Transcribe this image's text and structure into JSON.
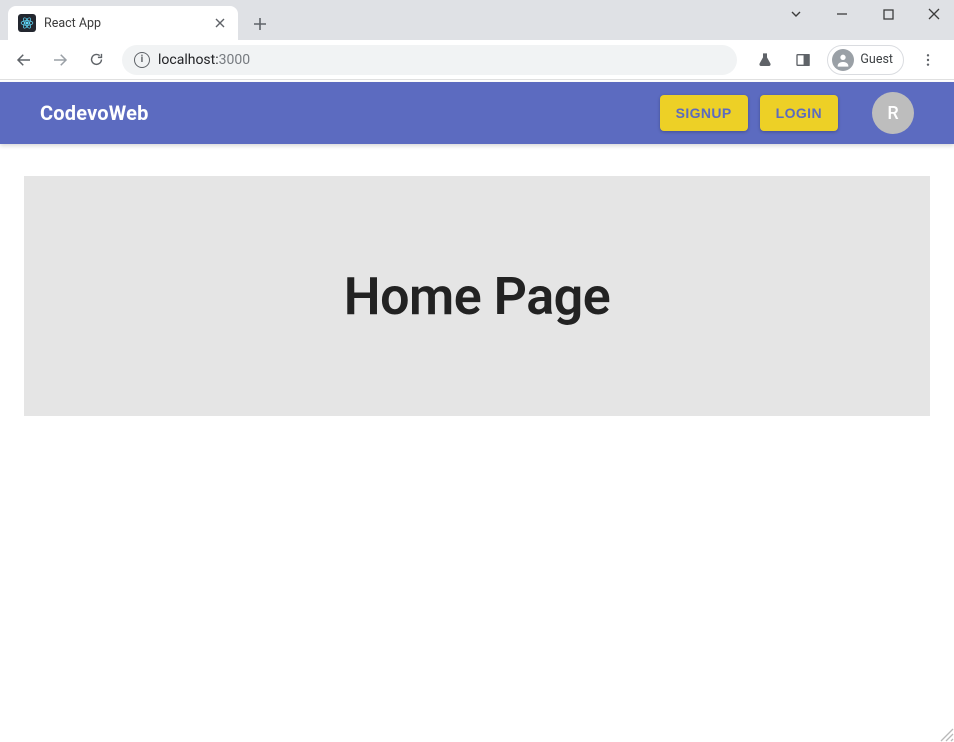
{
  "browser": {
    "tab_title": "React App",
    "url_host": "localhost:",
    "url_port": "3000",
    "guest_label": "Guest"
  },
  "header": {
    "brand": "CodevoWeb",
    "signup_label": "SIGNUP",
    "login_label": "LOGIN",
    "avatar_initial": "R"
  },
  "main": {
    "hero_title": "Home Page"
  },
  "colors": {
    "appbar": "#5c6bc0",
    "button_bg": "#edd026",
    "hero_bg": "#e5e5e5"
  }
}
